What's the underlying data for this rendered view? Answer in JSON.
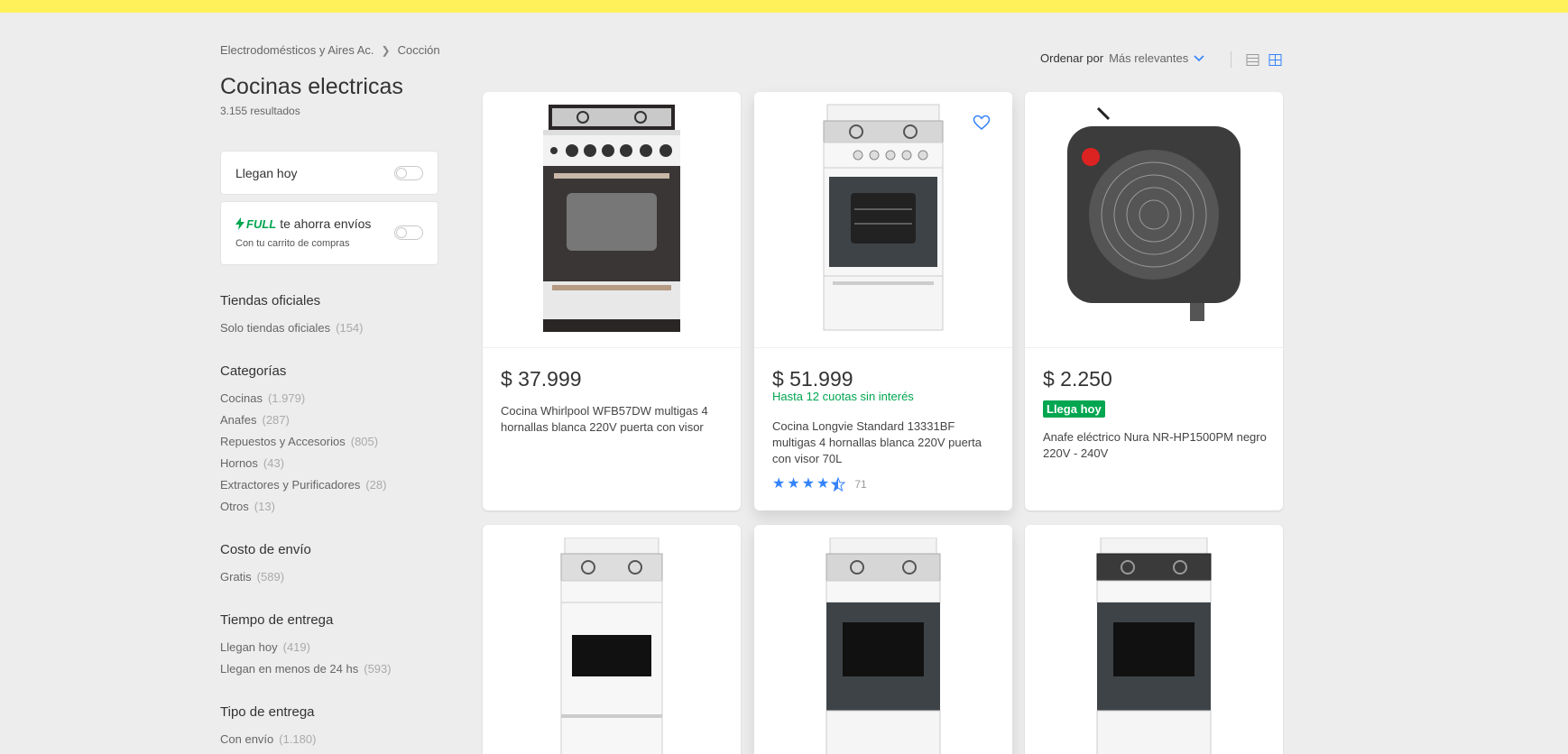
{
  "breadcrumb": {
    "parent": "Electrodomésticos y Aires Ac.",
    "current": "Cocción"
  },
  "page_title": "Cocinas electricas",
  "results": "3.155 resultados",
  "toggles": {
    "llegan_hoy": "Llegan hoy",
    "full_badge": "FULL",
    "full_text": "te ahorra envíos",
    "full_sub": "Con tu carrito de compras"
  },
  "filters": {
    "tiendas": {
      "title": "Tiendas oficiales",
      "items": [
        {
          "label": "Solo tiendas oficiales",
          "count": "(154)"
        }
      ]
    },
    "categorias": {
      "title": "Categorías",
      "items": [
        {
          "label": "Cocinas",
          "count": "(1.979)"
        },
        {
          "label": "Anafes",
          "count": "(287)"
        },
        {
          "label": "Repuestos y Accesorios",
          "count": "(805)"
        },
        {
          "label": "Hornos",
          "count": "(43)"
        },
        {
          "label": "Extractores y Purificadores",
          "count": "(28)"
        },
        {
          "label": "Otros",
          "count": "(13)"
        }
      ]
    },
    "costo": {
      "title": "Costo de envío",
      "items": [
        {
          "label": "Gratis",
          "count": "(589)"
        }
      ]
    },
    "tiempo": {
      "title": "Tiempo de entrega",
      "items": [
        {
          "label": "Llegan hoy",
          "count": "(419)"
        },
        {
          "label": "Llegan en menos de 24 hs",
          "count": "(593)"
        }
      ]
    },
    "tipo": {
      "title": "Tipo de entrega",
      "items": [
        {
          "label": "Con envío",
          "count": "(1.180)"
        }
      ]
    }
  },
  "sort": {
    "label": "Ordenar por",
    "value": "Más relevantes"
  },
  "products": [
    {
      "price": "$ 37.999",
      "title": "Cocina Whirlpool WFB57DW multigas 4 hornallas blanca 220V puerta con visor"
    },
    {
      "price": "$ 51.999",
      "installments": "Hasta 12 cuotas sin interés",
      "title": "Cocina Longvie Standard 13331BF multigas 4 hornallas blanca 220V puerta con visor 70L",
      "rating": 4.5,
      "reviews": "71"
    },
    {
      "price": "$ 2.250",
      "badge": "Llega hoy",
      "title": "Anafe eléctrico Nura NR-HP1500PM negro 220V - 240V"
    }
  ],
  "colors": {
    "topbar": "#fff159",
    "accent": "#3483fa",
    "green": "#00a650",
    "background": "#ededed"
  },
  "icons": [
    "chevron-right-icon",
    "chevron-down-icon",
    "list-view-icon",
    "grid-view-icon",
    "heart-icon",
    "bolt-icon",
    "star-icon"
  ]
}
